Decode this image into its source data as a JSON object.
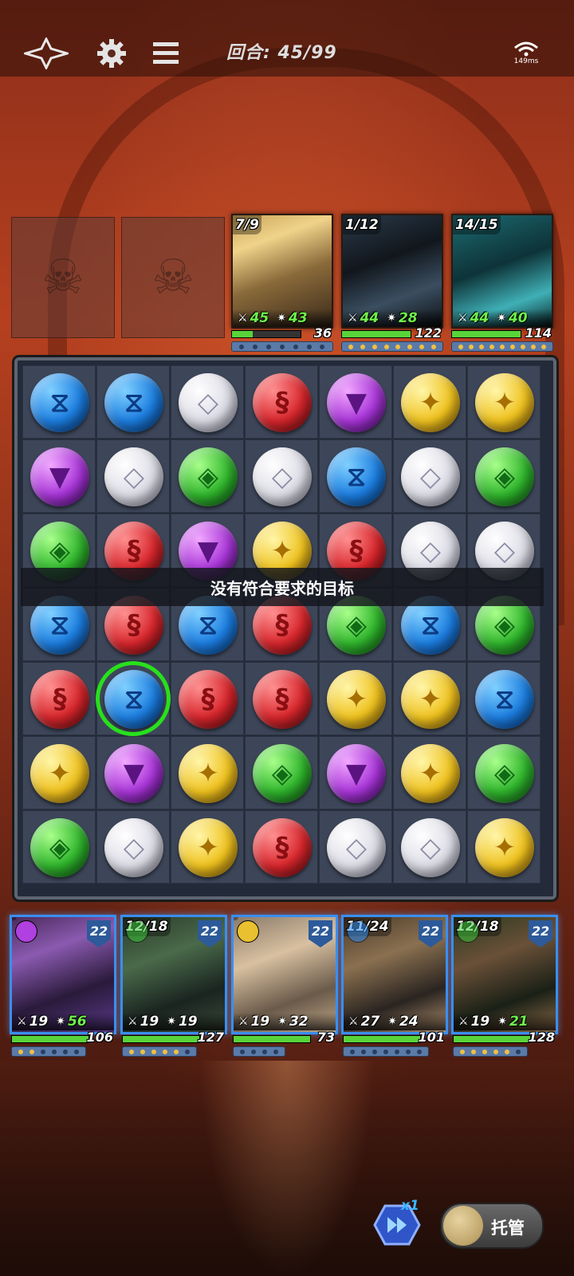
{
  "topbar": {
    "back_icon": "sparkle-arrow-icon",
    "settings_icon": "gear-icon",
    "menu_icon": "hamburger-menu-icon",
    "round_label": "回合: 45/99",
    "ping": "149ms"
  },
  "enemies": [
    {
      "cooldown": "7/9",
      "attack": "45",
      "defense": "43",
      "hp": "36",
      "hp_fraction": 0.3,
      "skill_dots": 7,
      "skill_on": 0
    },
    {
      "cooldown": "1/12",
      "attack": "44",
      "defense": "28",
      "hp": "122",
      "hp_fraction": 1.0,
      "skill_dots": 8,
      "skill_on": 8
    },
    {
      "cooldown": "14/15",
      "attack": "44",
      "defense": "40",
      "hp": "114",
      "hp_fraction": 1.0,
      "skill_dots": 9,
      "skill_on": 9
    }
  ],
  "board": {
    "rows": [
      [
        "blue",
        "blue",
        "white",
        "red",
        "purple",
        "yellow",
        "yellow"
      ],
      [
        "purple",
        "white",
        "green",
        "white",
        "blue",
        "white",
        "green"
      ],
      [
        "green",
        "red",
        "purple",
        "yellow",
        "red",
        "white",
        "white"
      ],
      [
        "blue",
        "red",
        "blue",
        "red",
        "green",
        "blue",
        "green"
      ],
      [
        "red",
        "blue",
        "red",
        "red",
        "yellow",
        "yellow",
        "blue"
      ],
      [
        "yellow",
        "purple",
        "yellow",
        "green",
        "purple",
        "yellow",
        "green"
      ],
      [
        "green",
        "white",
        "yellow",
        "red",
        "white",
        "white",
        "yellow"
      ]
    ],
    "selected": {
      "row": 4,
      "col": 1
    },
    "notice": "没有符合要求的目标"
  },
  "heroes": [
    {
      "cooldown": "",
      "level": "22",
      "attack": "19",
      "defense": "56",
      "hp": "106",
      "hp_fraction": 1.0,
      "skill_on": 2,
      "skill_dots": 6,
      "element": "purple",
      "attack_color": "#ffffff",
      "defense_color": "#6ef04a"
    },
    {
      "cooldown": "12/18",
      "level": "22",
      "attack": "19",
      "defense": "19",
      "hp": "127",
      "hp_fraction": 1.0,
      "skill_on": 5,
      "skill_dots": 6,
      "element": "green",
      "attack_color": "#ffffff",
      "defense_color": "#ffffff"
    },
    {
      "cooldown": "",
      "level": "22",
      "attack": "19",
      "defense": "32",
      "hp": "73",
      "hp_fraction": 1.0,
      "skill_on": 0,
      "skill_dots": 4,
      "element": "yellow",
      "attack_color": "#ffffff",
      "defense_color": "#ffffff"
    },
    {
      "cooldown": "11/24",
      "level": "22",
      "attack": "27",
      "defense": "24",
      "hp": "101",
      "hp_fraction": 1.0,
      "skill_on": 0,
      "skill_dots": 7,
      "element": "blue",
      "attack_color": "#ffffff",
      "defense_color": "#ffffff"
    },
    {
      "cooldown": "12/18",
      "level": "22",
      "attack": "19",
      "defense": "21",
      "hp": "128",
      "hp_fraction": 1.0,
      "skill_on": 5,
      "skill_dots": 6,
      "element": "green",
      "attack_color": "#ffffff",
      "defense_color": "#6ef04a"
    }
  ],
  "controls": {
    "speed_label": "x1",
    "speed_icon": "fast-forward-icon",
    "auto_label": "托管"
  },
  "colors": {
    "hp_green": "#58d43a",
    "select_green": "#28e01c",
    "accent_blue": "#39b7ff"
  }
}
